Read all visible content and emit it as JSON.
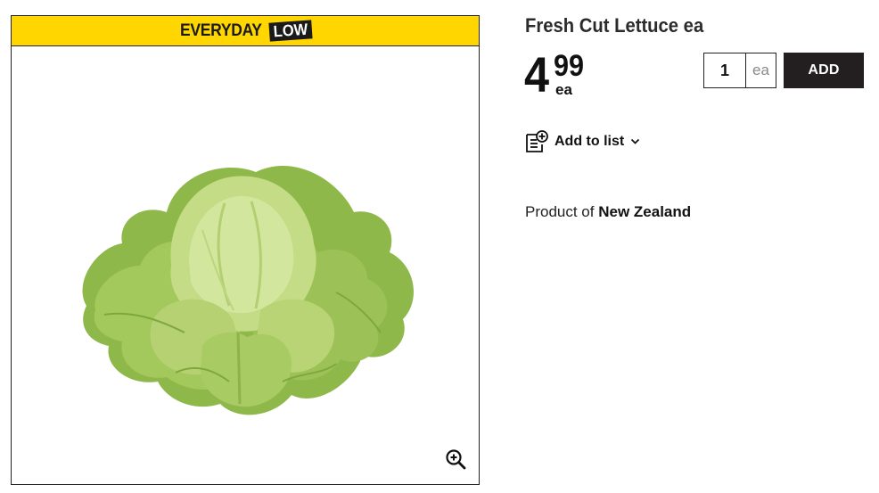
{
  "promo": {
    "word": "EVERYDAY",
    "tag": "LOW"
  },
  "product": {
    "title": "Fresh Cut Lettuce ea",
    "price_dollars": "4",
    "price_cents": "99",
    "price_unit": "ea",
    "origin_prefix": "Product of ",
    "origin_country": "New Zealand"
  },
  "cart": {
    "quantity": "1",
    "unit": "ea",
    "add_label": "ADD"
  },
  "list": {
    "label": "Add to list"
  },
  "icons": {
    "zoom": "zoom-in-icon",
    "list": "list-add-icon",
    "chevron": "chevron-down-icon"
  },
  "colors": {
    "promo_yellow": "#ffd600",
    "button_dark": "#231f20"
  }
}
